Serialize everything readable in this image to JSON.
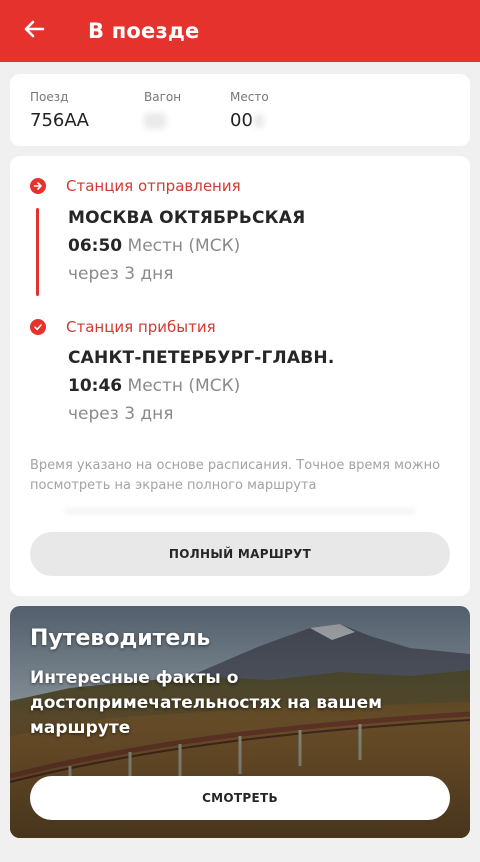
{
  "header": {
    "title": "В поезде",
    "back_icon": "arrow-left-icon",
    "color": "#e6322d"
  },
  "ticket": {
    "train_label": "Поезд",
    "train_value": "756АА",
    "car_label": "Вагон",
    "seat_label": "Место",
    "seat_value": "00"
  },
  "route": {
    "departure": {
      "label": "Станция отправления",
      "station": "МОСКВА ОКТЯБРЬСКАЯ",
      "time": "06:50",
      "tz": "Местн (МСК)",
      "relative": "через 3 дня"
    },
    "arrival": {
      "label": "Станция прибытия",
      "station": "САНКТ-ПЕТЕРБУРГ-ГЛАВН.",
      "time": "10:46",
      "tz": "Местн (МСК)",
      "relative": "через 3 дня"
    },
    "note": "Время указано на основе расписания. Точное время можно посмотреть на экране полного маршрута",
    "full_route_button": "ПОЛНЫЙ МАРШРУТ"
  },
  "guide": {
    "title": "Путеводитель",
    "text": "Интересные факты о достопримечательностях на вашем маршруте",
    "button": "СМОТРЕТЬ"
  }
}
